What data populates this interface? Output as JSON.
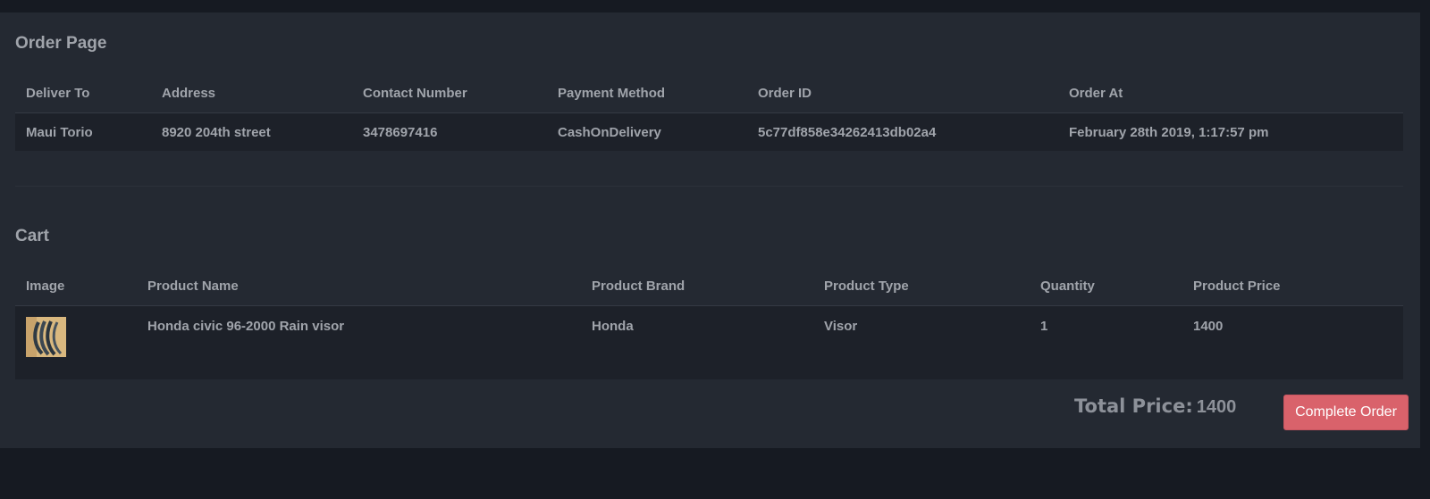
{
  "order": {
    "title": "Order Page",
    "headers": [
      "Deliver To",
      "Address",
      "Contact Number",
      "Payment Method",
      "Order ID",
      "Order At"
    ],
    "row": [
      "Maui Torio",
      "8920 204th street",
      "3478697416",
      "CashOnDelivery",
      "5c77df858e34262413db02a4",
      "February 28th 2019, 1:17:57 pm"
    ]
  },
  "cart": {
    "title": "Cart",
    "headers": [
      "Image",
      "Product Name",
      "Product Brand",
      "Product Type",
      "Quantity",
      "Product Price"
    ],
    "items": [
      {
        "image_icon": "rain-visor-product-image",
        "name": "Honda civic 96-2000 Rain visor",
        "brand": "Honda",
        "type": "Visor",
        "quantity": "1",
        "price": "1400"
      }
    ]
  },
  "summary": {
    "total_label": "Total Price:",
    "total_value": "1400",
    "complete_button": "Complete Order"
  },
  "colors": {
    "page_background": "#161a22",
    "panel_background": "#242932",
    "row_background": "#1d2129",
    "text": "#a0a4ab",
    "button": "#d9626b"
  }
}
